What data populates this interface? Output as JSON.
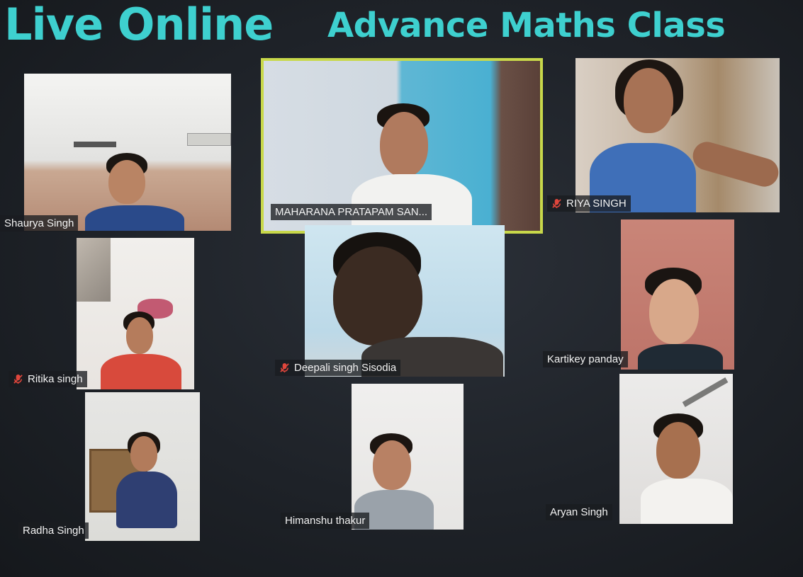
{
  "header": {
    "title_part1": "Live Online",
    "title_part2": "Advance Maths Class"
  },
  "participants": [
    {
      "name": "Shaurya Singh",
      "muted": false
    },
    {
      "name": "MAHARANA PRATAPAM SAN...",
      "muted": false,
      "active_speaker": true
    },
    {
      "name": "RIYA SINGH",
      "muted": true
    },
    {
      "name": "Ritika singh",
      "muted": true
    },
    {
      "name": "Deepali singh Sisodia",
      "muted": true
    },
    {
      "name": "Kartikey panday",
      "muted": false
    },
    {
      "name": "Radha Singh",
      "muted": false
    },
    {
      "name": "Himanshu  thakur",
      "muted": false
    },
    {
      "name": "Aryan Singh",
      "muted": false
    }
  ],
  "colors": {
    "title": "#3ed0cf",
    "active_border": "#c8d84a",
    "mute_icon": "#e0463c"
  }
}
